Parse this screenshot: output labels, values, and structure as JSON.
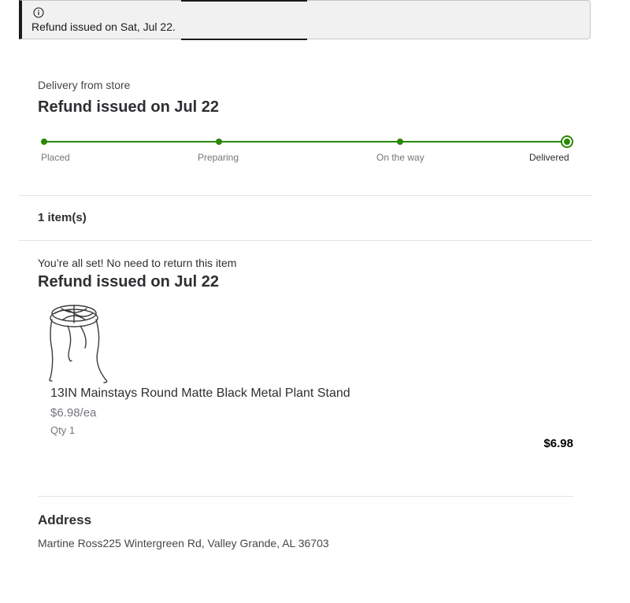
{
  "alert": {
    "icon": "info-icon",
    "text": "Refund issued on Sat, Jul 22."
  },
  "delivery": {
    "subtitle": "Delivery from store",
    "title": "Refund issued on Jul 22",
    "steps": [
      "Placed",
      "Preparing",
      "On the way",
      "Delivered"
    ],
    "current_step": "Delivered",
    "accent_color": "#2a8703"
  },
  "items": {
    "count_label": "1 item(s)"
  },
  "item_status": {
    "note": "You’re all set! No need to return this item",
    "title": "Refund issued on Jul 22"
  },
  "product": {
    "image_icon": "plant-stand-image",
    "name": "13IN Mainstays Round Matte Black Metal Plant Stand",
    "unit_price": "$6.98/ea",
    "qty": "Qty 1",
    "total": "$6.98"
  },
  "address": {
    "title": "Address",
    "text": "Martine Ross225 Wintergreen Rd, Valley Grande, AL 36703"
  }
}
